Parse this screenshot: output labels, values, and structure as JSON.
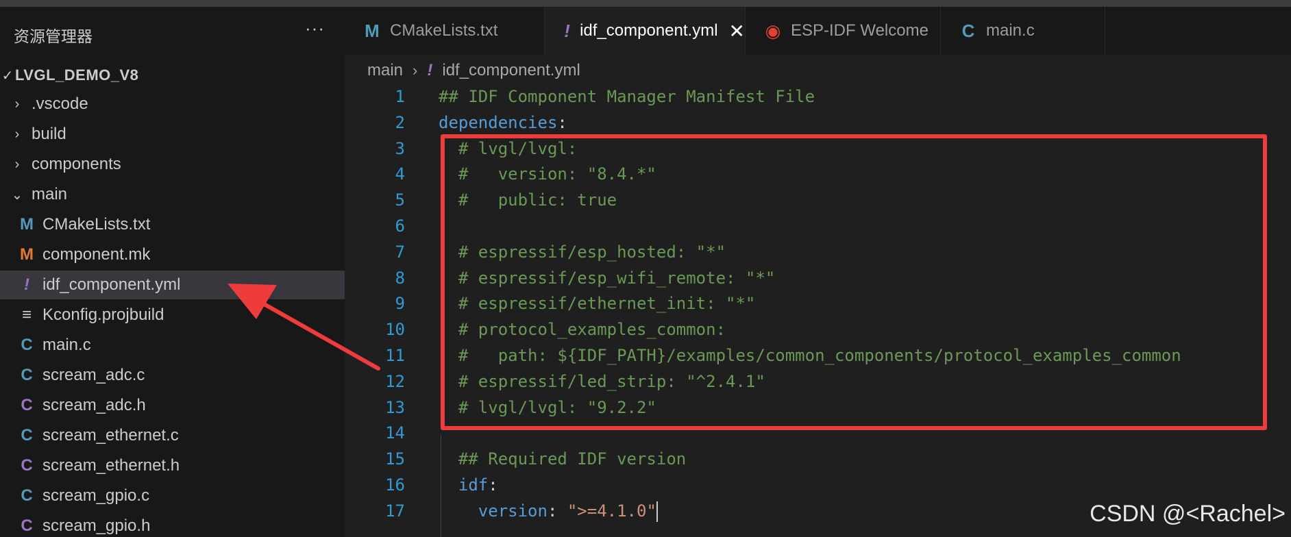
{
  "explorer": {
    "title": "资源管理器",
    "more_label": "···",
    "root": "LVGL_DEMO_V8",
    "items": [
      {
        "label": ".vscode",
        "type": "folder",
        "icon": "chevron-right-icon"
      },
      {
        "label": "build",
        "type": "folder",
        "icon": "chevron-right-icon"
      },
      {
        "label": "components",
        "type": "folder",
        "icon": "chevron-right-icon"
      },
      {
        "label": "main",
        "type": "folder-open",
        "icon": "chevron-down-icon"
      },
      {
        "label": "CMakeLists.txt",
        "type": "file",
        "icon_glyph": "M",
        "icon_color": "#519aba"
      },
      {
        "label": "component.mk",
        "type": "file",
        "icon_glyph": "M",
        "icon_color": "#e37933"
      },
      {
        "label": "idf_component.yml",
        "type": "file",
        "icon_glyph": "!",
        "icon_color": "#a074c4",
        "selected": true
      },
      {
        "label": "Kconfig.projbuild",
        "type": "file",
        "icon_glyph": "≡",
        "icon_color": "#cccccc"
      },
      {
        "label": "main.c",
        "type": "file",
        "icon_glyph": "C",
        "icon_color": "#519aba"
      },
      {
        "label": "scream_adc.c",
        "type": "file",
        "icon_glyph": "C",
        "icon_color": "#519aba"
      },
      {
        "label": "scream_adc.h",
        "type": "file",
        "icon_glyph": "C",
        "icon_color": "#a074c4"
      },
      {
        "label": "scream_ethernet.c",
        "type": "file",
        "icon_glyph": "C",
        "icon_color": "#519aba"
      },
      {
        "label": "scream_ethernet.h",
        "type": "file",
        "icon_glyph": "C",
        "icon_color": "#a074c4"
      },
      {
        "label": "scream_gpio.c",
        "type": "file",
        "icon_glyph": "C",
        "icon_color": "#519aba"
      },
      {
        "label": "scream_gpio.h",
        "type": "file",
        "icon_glyph": "C",
        "icon_color": "#a074c4"
      }
    ]
  },
  "tabs": [
    {
      "label": "CMakeLists.txt",
      "icon_glyph": "M",
      "icon_color": "#519aba"
    },
    {
      "label": "idf_component.yml",
      "icon_glyph": "!",
      "icon_color": "#a074c4",
      "active": true,
      "close": "✕"
    },
    {
      "label": "ESP-IDF Welcome",
      "icon_glyph": "◉",
      "icon_color": "#e7412f"
    },
    {
      "label": "main.c",
      "icon_glyph": "C",
      "icon_color": "#519aba"
    }
  ],
  "breadcrumb": {
    "folder": "main",
    "sep": "›",
    "file": "idf_component.yml"
  },
  "editor": {
    "lines": [
      {
        "n": "1",
        "parts": [
          [
            "c-comment",
            "## IDF Component Manager Manifest File"
          ]
        ]
      },
      {
        "n": "2",
        "parts": [
          [
            "c-key",
            "dependencies"
          ],
          [
            "c-punc",
            ":"
          ]
        ]
      },
      {
        "n": "3",
        "parts": [
          [
            "c-comment",
            "  # lvgl/lvgl:"
          ]
        ]
      },
      {
        "n": "4",
        "parts": [
          [
            "c-comment",
            "  #   version: \"8.4.*\""
          ]
        ]
      },
      {
        "n": "5",
        "parts": [
          [
            "c-comment",
            "  #   public: true"
          ]
        ]
      },
      {
        "n": "6",
        "parts": []
      },
      {
        "n": "7",
        "parts": [
          [
            "c-comment",
            "  # espressif/esp_hosted: \"*\""
          ]
        ]
      },
      {
        "n": "8",
        "parts": [
          [
            "c-comment",
            "  # espressif/esp_wifi_remote: \"*\""
          ]
        ]
      },
      {
        "n": "9",
        "parts": [
          [
            "c-comment",
            "  # espressif/ethernet_init: \"*\""
          ]
        ]
      },
      {
        "n": "10",
        "parts": [
          [
            "c-comment",
            "  # protocol_examples_common:"
          ]
        ]
      },
      {
        "n": "11",
        "parts": [
          [
            "c-comment",
            "  #   path: ${IDF_PATH}/examples/common_components/protocol_examples_common"
          ]
        ]
      },
      {
        "n": "12",
        "parts": [
          [
            "c-comment",
            "  # espressif/led_strip: \"^2.4.1\""
          ]
        ]
      },
      {
        "n": "13",
        "parts": [
          [
            "c-comment",
            "  # lvgl/lvgl: \"9.2.2\""
          ]
        ]
      },
      {
        "n": "14",
        "parts": []
      },
      {
        "n": "15",
        "parts": [
          [
            "c-comment",
            "  ## Required IDF version"
          ]
        ]
      },
      {
        "n": "16",
        "parts": [
          [
            "c-key",
            "  idf"
          ],
          [
            "c-punc",
            ":"
          ]
        ]
      },
      {
        "n": "17",
        "parts": [
          [
            "c-key",
            "    version"
          ],
          [
            "c-punc",
            ": "
          ],
          [
            "c-str",
            "\">=4.1.0\""
          ]
        ],
        "cursor": true
      }
    ]
  },
  "watermark": "CSDN @<Rachel>",
  "colors": {
    "highlight": "#ee3b3b",
    "arrow": "#ee3b3b"
  }
}
